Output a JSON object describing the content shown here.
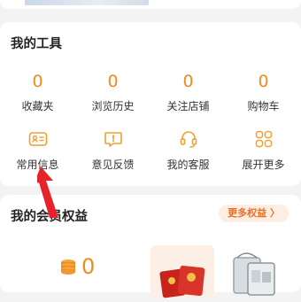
{
  "tools_section": {
    "title": "我的工具",
    "counters": [
      {
        "value": "0",
        "label": "收藏夹"
      },
      {
        "value": "0",
        "label": "浏览历史"
      },
      {
        "value": "0",
        "label": "关注店铺"
      },
      {
        "value": "0",
        "label": "购物车"
      }
    ],
    "tools": [
      {
        "label": "常用信息",
        "icon": "id-card-icon"
      },
      {
        "label": "意见反馈",
        "icon": "feedback-icon"
      },
      {
        "label": "我的客服",
        "icon": "headset-icon"
      },
      {
        "label": "展开更多",
        "icon": "grid-icon"
      }
    ]
  },
  "member_section": {
    "title": "我的会员权益",
    "more_label": "更多权益 〉",
    "coin_value": "0"
  },
  "colors": {
    "accent": "#f08a1c",
    "annotation_arrow": "#e8222a"
  }
}
